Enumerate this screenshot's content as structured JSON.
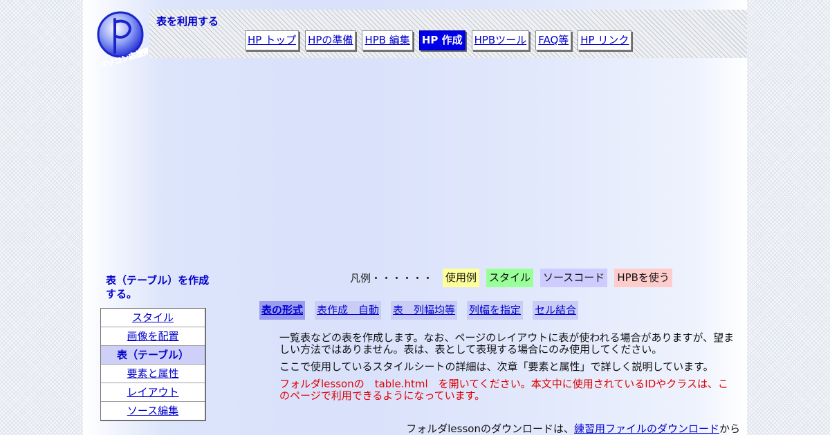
{
  "site": {
    "title": "表を利用する",
    "logo_text": "パソコン応援隊"
  },
  "nav": {
    "items": [
      {
        "label": "HP トップ",
        "active": false
      },
      {
        "label": "HPの準備",
        "active": false
      },
      {
        "label": "HPB 編集",
        "active": false
      },
      {
        "label": "HP 作成",
        "active": true
      },
      {
        "label": "HPBツール",
        "active": false
      },
      {
        "label": "FAQ等",
        "active": false
      },
      {
        "label": "HP リンク",
        "active": false
      }
    ]
  },
  "sidebar": {
    "title": "表（テーブル）を作成する。",
    "items": [
      {
        "label": "スタイル",
        "active": false
      },
      {
        "label": "画像を配置",
        "active": false
      },
      {
        "label": "表（テーブル）",
        "active": true
      },
      {
        "label": "要素と属性",
        "active": false
      },
      {
        "label": "レイアウト",
        "active": false
      },
      {
        "label": "ソース編集",
        "active": false
      }
    ]
  },
  "legend": {
    "label": "凡例・・・・・・",
    "chips": [
      {
        "label": "使用例",
        "color": "#ffff99"
      },
      {
        "label": "スタイル",
        "color": "#99ff99"
      },
      {
        "label": "ソースコード",
        "color": "#ccccff"
      },
      {
        "label": "HPBを使う",
        "color": "#ffcccc"
      }
    ]
  },
  "subtabs": [
    {
      "label": "表の形式",
      "active": true
    },
    {
      "label": "表作成　自動",
      "active": false
    },
    {
      "label": "表　列幅均等",
      "active": false
    },
    {
      "label": "列幅を指定",
      "active": false
    },
    {
      "label": "セル結合",
      "active": false
    }
  ],
  "content": {
    "p1": "一覧表などの表を作成します。なお、ページのレイアウトに表が使われる場合がありますが、望ましい方法ではありません。表は、表として表現する場合にのみ使用してください。",
    "p2": "ここで使用しているスタイルシートの詳細は、次章「要素と属性」で詳しく説明しています。",
    "p3": "フォルダlessonの　table.html　を開いてください。本文中に使用されているIDやクラスは、このページで利用できるようになっています。",
    "download_prefix": "フォルダlessonのダウンロードは、",
    "download_link": "練習用ファイルのダウンロード",
    "download_suffix": "から"
  },
  "colors": {
    "link": "#0000cc",
    "nav_active": "#0000e8",
    "notice_red": "#e00000"
  }
}
